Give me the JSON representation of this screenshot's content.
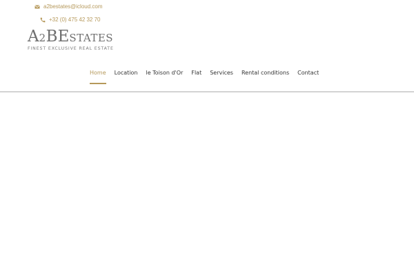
{
  "contact": {
    "email": "a2bestates@icloud.com",
    "email_icon": "envelope-icon",
    "phone": "+32 (0) 475 42 32 70",
    "phone_icon": "phone-icon"
  },
  "logo": {
    "letter_a": "A",
    "digit_2": "2",
    "letter_b": "B",
    "letter_e": "E",
    "rest": "STATES",
    "tagline": "FINEST EXCLUSIVE REAL ESTATE"
  },
  "nav": {
    "items": [
      {
        "label": "Home",
        "active": true
      },
      {
        "label": "Location"
      },
      {
        "label": "le Toison d'Or"
      },
      {
        "label": "Flat"
      },
      {
        "label": "Services"
      },
      {
        "label": "Rental conditions"
      },
      {
        "label": "Contact"
      }
    ]
  },
  "colors": {
    "accent": "#b5985a",
    "text": "#333333",
    "logo": "#6f6f6f",
    "divider": "#d3d3d3"
  }
}
